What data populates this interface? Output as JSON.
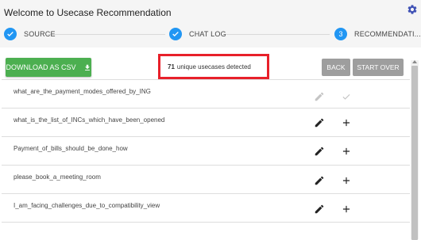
{
  "app": {
    "title": "Welcome to Usecase Recommendation"
  },
  "stepper": {
    "steps": [
      {
        "label": "SOURCE",
        "status": "done"
      },
      {
        "label": "CHAT LOG",
        "status": "done"
      },
      {
        "label": "RECOMMENDATI...",
        "number": "3",
        "status": "active"
      }
    ]
  },
  "toolbar": {
    "download_label": "DOWNLOAD AS CSV",
    "count": "71",
    "count_suffix": "unique usecases detected",
    "back_label": "BACK",
    "start_over_label": "START OVER"
  },
  "usecases": [
    {
      "text": "what_are_the_payment_modes_offered_by_ING",
      "state": "added"
    },
    {
      "text": "what_is_the_list_of_INCs_which_have_been_opened",
      "state": "default"
    },
    {
      "text": "Payment_of_bills_should_be_done_how",
      "state": "default"
    },
    {
      "text": "please_book_a_meeting_room",
      "state": "default"
    },
    {
      "text": "I_am_facing_challenges_due_to_compatibility_view",
      "state": "default"
    }
  ],
  "colors": {
    "accent": "#2196f3",
    "download_button": "#4caf50",
    "secondary_button": "#9e9e9e",
    "highlight_border": "#e8202a"
  },
  "icons": {
    "settings": "gear-icon",
    "step_done": "check-circle-icon",
    "download": "download-icon",
    "edit": "pencil-icon",
    "add": "plus-icon",
    "added": "check-icon"
  }
}
